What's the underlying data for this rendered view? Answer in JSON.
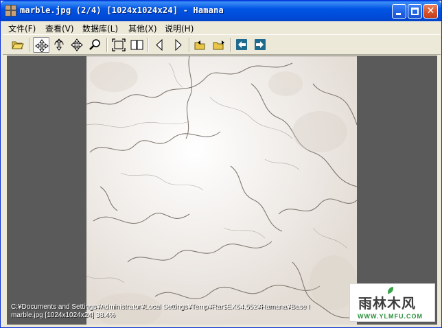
{
  "window": {
    "title": "marble.jpg (2/4) [1024x1024x24] - Hamana",
    "controls": {
      "minimize": "minimize",
      "maximize": "maximize",
      "close": "close"
    }
  },
  "menu": {
    "items": [
      "文件(F)",
      "查看(V)",
      "数据库(L)",
      "其他(X)",
      "说明(H)"
    ]
  },
  "toolbar": {
    "tools": [
      "open-folder-icon",
      "move-icon",
      "rotate-move-icon",
      "four-way-move-icon",
      "magnifier-icon",
      "fit-window-icon",
      "two-page-icon",
      "previous-icon",
      "next-icon",
      "folder-previous-icon",
      "folder-next-icon",
      "arrow-left-icon",
      "arrow-right-icon"
    ],
    "active_tool": "move-icon"
  },
  "status": {
    "path": "C:¥Documents and Settings¥Administrator¥Local Settings¥Temp¥Rar$EX64.552¥Hamana¥Base I",
    "info": "marble.jpg [1024x1024x24] 38.4%"
  },
  "watermark": {
    "title": "雨林木风",
    "url": "WWW.YLMFU.COM"
  },
  "colors": {
    "titlebar": "#0054e3",
    "viewer_bg": "#5a5a5a",
    "window_bg": "#ece9d8",
    "accent_green": "#2a8f3a"
  }
}
